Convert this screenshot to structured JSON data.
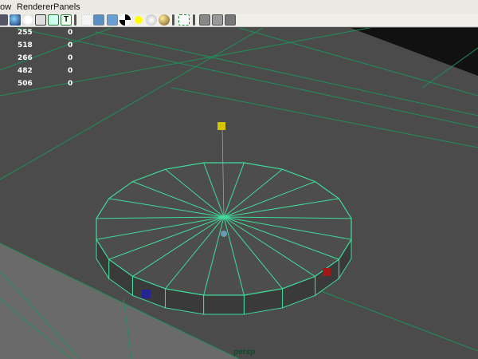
{
  "menu": {
    "items": [
      "ow",
      "Renderer",
      "Panels"
    ]
  },
  "toolbar": {
    "icons": [
      "grid-icon",
      "sphere-shade-icon",
      "light-circle-icon",
      "isolate-icon",
      "texture-icon",
      "text-icon",
      "separator",
      "bounding-box-icon",
      "smooth-shade-icon",
      "wireframe-shade-icon",
      "checker-icon",
      "default-light-icon",
      "all-lights-icon",
      "material-sphere-icon",
      "separator",
      "select-region-icon",
      "separator",
      "xray-icon",
      "xray-joints-icon",
      "share-icon"
    ]
  },
  "hud": {
    "rows": [
      {
        "a": "255",
        "b": "0"
      },
      {
        "a": "518",
        "b": "0"
      },
      {
        "a": "266",
        "b": "0"
      },
      {
        "a": "482",
        "b": "0"
      },
      {
        "a": "506",
        "b": "0"
      }
    ]
  },
  "camera_label": "persp",
  "colors": {
    "wire": "#3fdc9c",
    "grid": "#1f8f5a",
    "background": "#4b4b4b",
    "floor": "#6a6a6a"
  }
}
